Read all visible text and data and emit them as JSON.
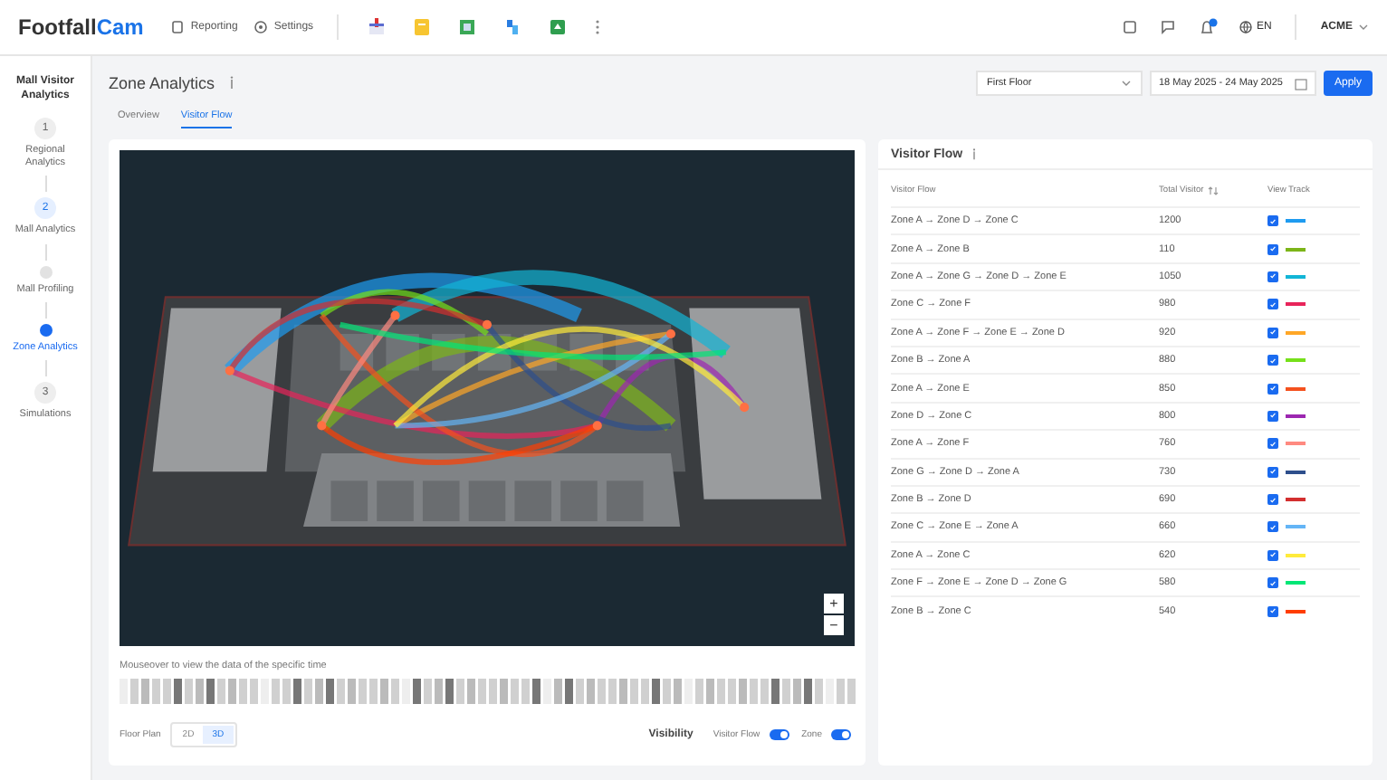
{
  "topbar": {
    "logo": {
      "first": "Footfall",
      "second": "Cam"
    },
    "nav": [
      {
        "kind": "reports",
        "label": "Reporting"
      },
      {
        "kind": "settings",
        "label": "Settings"
      }
    ],
    "language": "EN",
    "account": "ACME"
  },
  "sidebar": {
    "title": "Mall Visitor Analytics",
    "steps": [
      {
        "kind": "step",
        "number": "1",
        "label": "Regional Analytics",
        "selected": false
      },
      {
        "kind": "step",
        "number": "2",
        "label": "Mall Analytics",
        "selected": true
      },
      {
        "kind": "substep",
        "label": "Mall Profiling",
        "selected": false
      },
      {
        "kind": "substep",
        "label": "Zone Analytics",
        "selected": true
      },
      {
        "kind": "step",
        "number": "3",
        "label": "Simulations",
        "selected": false
      }
    ]
  },
  "page": {
    "title": "Zone Analytics",
    "tabs": [
      {
        "label": "Overview",
        "selected": false
      },
      {
        "label": "Visitor Flow",
        "selected": true
      }
    ],
    "floor_select": "First Floor",
    "date_range": "18 May 2025 - 24 May 2025",
    "apply": "Apply"
  },
  "map": {
    "zoom_in": "+",
    "zoom_out": "−",
    "hint": "Mouseover to view the data of the specific time",
    "floor_plan": {
      "label": "Floor Plan",
      "options": [
        {
          "label": "2D",
          "selected": false
        },
        {
          "label": "3D",
          "selected": true
        }
      ]
    },
    "visibility": {
      "label": "Visibility",
      "toggles": [
        {
          "label": "Visitor Flow",
          "on": true
        },
        {
          "label": "Zone",
          "on": true
        }
      ]
    }
  },
  "flow_panel": {
    "title": "Visitor Flow",
    "columns": [
      "Visitor Flow",
      "Total Visitor",
      "View Track"
    ],
    "rows": [
      {
        "flow": "Zone A → Zone D → Zone C",
        "total": "1200",
        "checked": true,
        "color": "#1e9bf0"
      },
      {
        "flow": "Zone A → Zone B",
        "total": "110",
        "checked": true,
        "color": "#7cb518"
      },
      {
        "flow": "Zone A → Zone G → Zone D → Zone E",
        "total": "1050",
        "checked": true,
        "color": "#12b5d6"
      },
      {
        "flow": "Zone C → Zone F",
        "total": "980",
        "checked": true,
        "color": "#e8245a"
      },
      {
        "flow": "Zone A → Zone F → Zone E → Zone D",
        "total": "920",
        "checked": true,
        "color": "#ffa726"
      },
      {
        "flow": "Zone B → Zone A",
        "total": "880",
        "checked": true,
        "color": "#76e01a"
      },
      {
        "flow": "Zone A → Zone E",
        "total": "850",
        "checked": true,
        "color": "#f4511e"
      },
      {
        "flow": "Zone D → Zone C",
        "total": "800",
        "checked": true,
        "color": "#9c27b0"
      },
      {
        "flow": "Zone A → Zone F",
        "total": "760",
        "checked": true,
        "color": "#ff8a80"
      },
      {
        "flow": "Zone G → Zone D → Zone A",
        "total": "730",
        "checked": true,
        "color": "#2e4f8c"
      },
      {
        "flow": "Zone B → Zone D",
        "total": "690",
        "checked": true,
        "color": "#d32f2f"
      },
      {
        "flow": "Zone C → Zone E → Zone A",
        "total": "660",
        "checked": true,
        "color": "#64b5f6"
      },
      {
        "flow": "Zone A → Zone C",
        "total": "620",
        "checked": true,
        "color": "#ffeb3b"
      },
      {
        "flow": "Zone F → Zone E → Zone D → Zone G",
        "total": "580",
        "checked": true,
        "color": "#00e676"
      },
      {
        "flow": "Zone B → Zone C",
        "total": "540",
        "checked": true,
        "color": "#ff3d00"
      }
    ]
  }
}
